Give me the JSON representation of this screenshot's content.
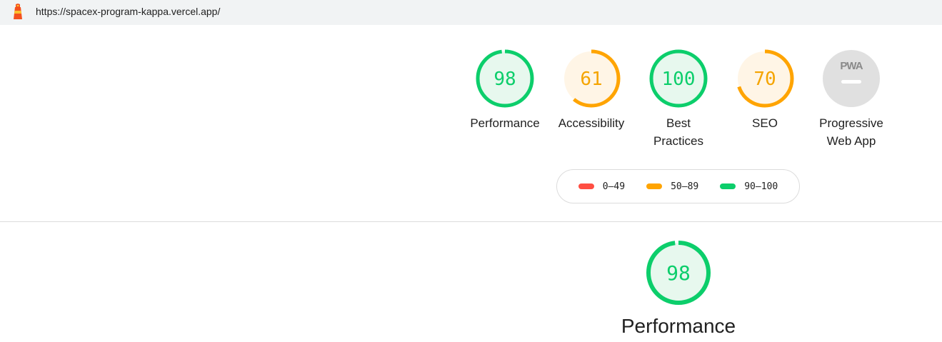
{
  "browser": {
    "url": "https://spacex-program-kappa.vercel.app/",
    "logo_icon": "lighthouse-icon"
  },
  "colors": {
    "pass": "#0cce6b",
    "pass_bg": "#e7f8ee",
    "pass_text": "#0cce6b",
    "average": "#ffa400",
    "average_bg": "#fff5e6",
    "average_text": "#f5a400",
    "fail": "#ff4e42",
    "na": "#e0e0e0"
  },
  "gauges": [
    {
      "id": "performance",
      "score": "98",
      "value": 98,
      "label": "Performance",
      "rating": "pass"
    },
    {
      "id": "accessibility",
      "score": "61",
      "value": 61,
      "label": "Accessibility",
      "rating": "average"
    },
    {
      "id": "best-practices",
      "score": "100",
      "value": 100,
      "label": "Best Practices",
      "rating": "pass"
    },
    {
      "id": "seo",
      "score": "70",
      "value": 70,
      "label": "SEO",
      "rating": "average"
    },
    {
      "id": "pwa",
      "score": "PWA",
      "label": "Progressive Web App",
      "rating": "na"
    }
  ],
  "legend": [
    {
      "range": "0–49",
      "rating": "fail"
    },
    {
      "range": "50–89",
      "rating": "average"
    },
    {
      "range": "90–100",
      "rating": "pass"
    }
  ],
  "performance_section": {
    "score": "98",
    "value": 98,
    "title": "Performance"
  }
}
